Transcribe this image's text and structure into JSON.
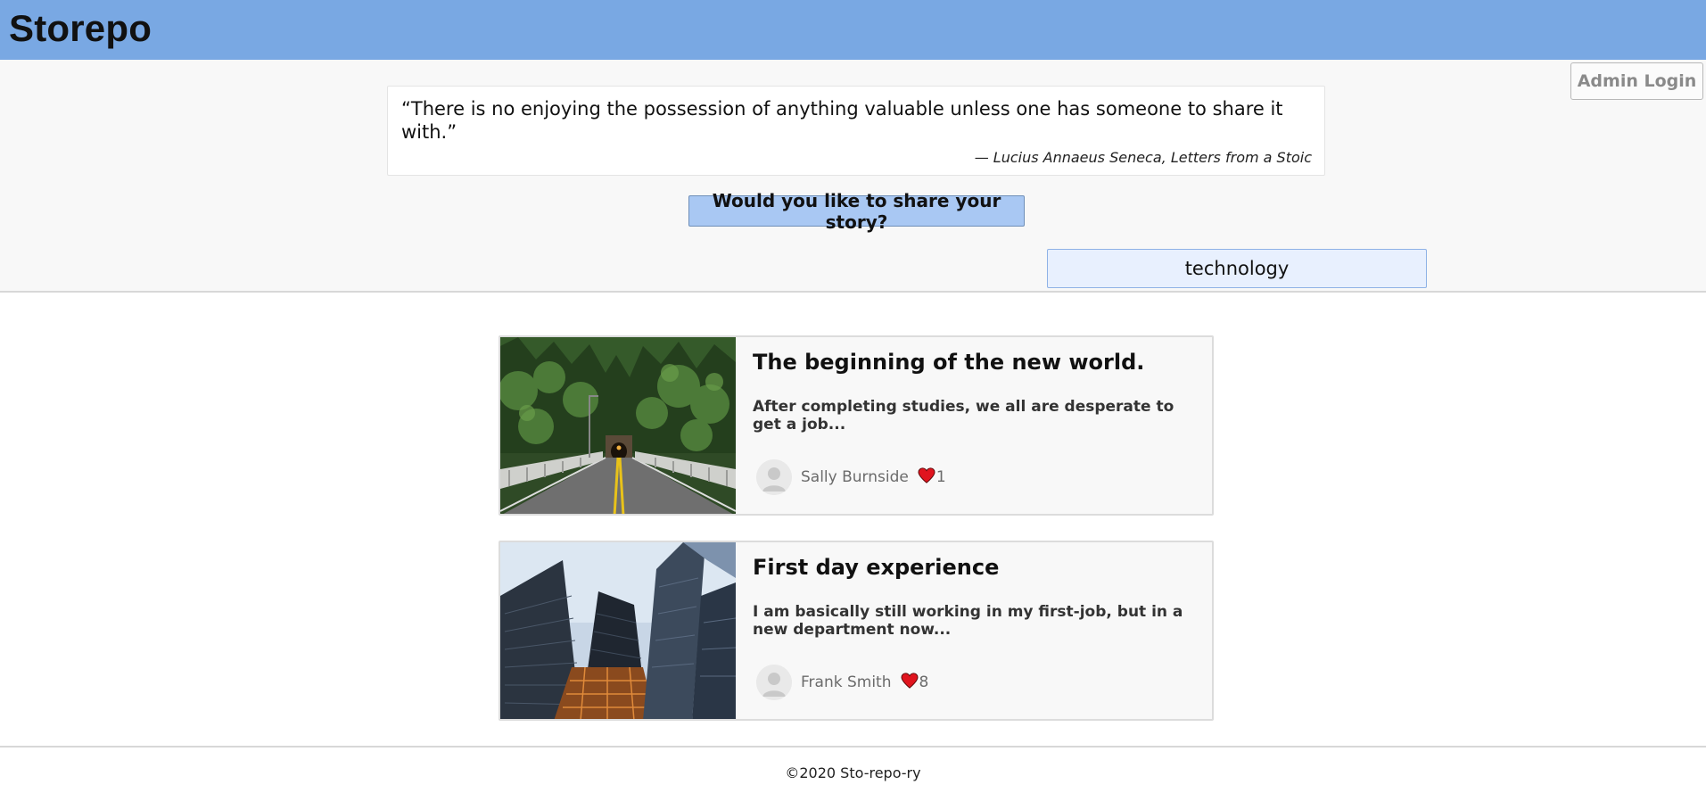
{
  "header": {
    "brand": "Storepo"
  },
  "hero": {
    "admin_login_label": "Admin Login",
    "quote": {
      "text": "“There is no enjoying the possession of anything valuable unless one has someone to share it with.”",
      "source": "— Lucius Annaeus Seneca, Letters from a Stoic"
    },
    "share_button_label": "Would you like to share your story?",
    "search": {
      "value": "technology"
    }
  },
  "stories": [
    {
      "title": "The beginning of the new world.",
      "excerpt": "After completing studies, we all are desperate to get a job...",
      "author": "Sally Burnside",
      "likes": "1",
      "image": "photo of a road leading into a tunnel through a forest"
    },
    {
      "title": "First day experience",
      "excerpt": "I am basically still working in my first-job, but in a new department now...",
      "author": "Frank Smith",
      "likes": "8",
      "image": "upward view of glass skyscrapers"
    }
  ],
  "footer": {
    "copyright": "©2020 Sto-repo-ry"
  },
  "colors": {
    "topbar": "#79a8e3",
    "share_button": "#a9c8f3",
    "heart": "#e0141e"
  }
}
